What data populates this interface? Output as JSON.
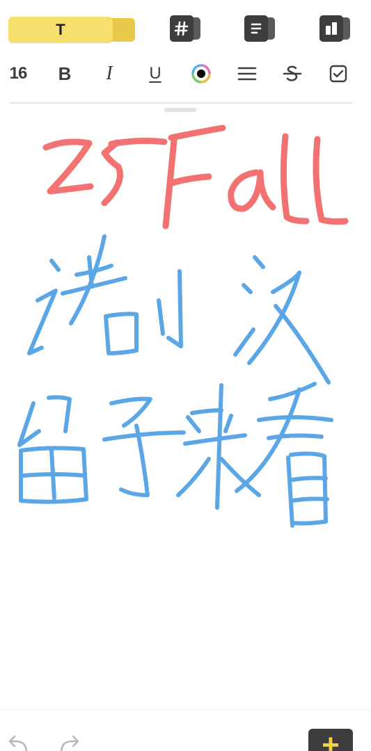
{
  "toolbar": {
    "text_tool_label": "T",
    "modes": [
      "tag-notebook-icon",
      "note-list-icon",
      "grid-view-icon"
    ]
  },
  "format": {
    "font_size": "16",
    "bold_label": "B",
    "italic_label": "I",
    "underline_label": "U",
    "color_value": "#000000"
  },
  "bottom": {
    "add_label": "+"
  },
  "colors": {
    "accent_yellow": "#f7df6e",
    "ink_red": "#f26b6b",
    "ink_blue": "#5aa6e6",
    "dark_button": "#3d3d3d"
  }
}
